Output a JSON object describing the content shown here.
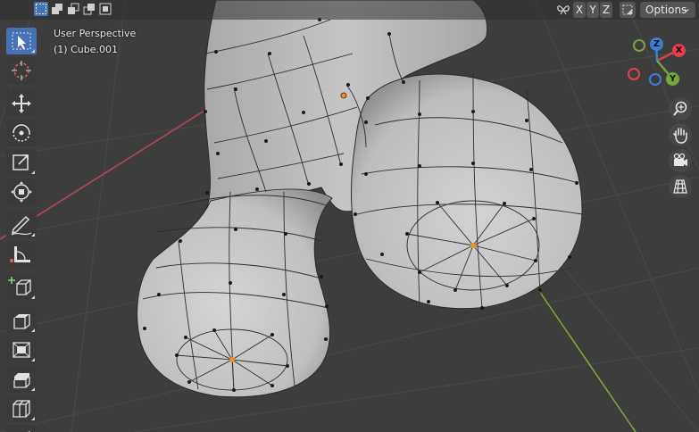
{
  "viewport": {
    "mode": "User Perspective",
    "object": "(1) Cube.001"
  },
  "header": {
    "axis_x": "X",
    "axis_y": "Y",
    "axis_z": "Z",
    "options_label": "Options",
    "options_arrow": "⌄"
  },
  "gizmo": {
    "x_label": "X",
    "y_label": "Y",
    "z_label": "Z"
  },
  "colors": {
    "accent": "#4772b3",
    "x_axis": "#e3404f",
    "y_axis": "#77a83a",
    "z_axis": "#3e7fd6",
    "mesh_surface": "#c8c8c8",
    "background": "#3d3d3d"
  },
  "icons": [
    "select-box-icon",
    "cursor-icon",
    "move-icon",
    "rotate-icon",
    "scale-icon",
    "transform-icon",
    "annotate-icon",
    "measure-icon",
    "add-cube-icon",
    "extrude-icon",
    "inset-icon",
    "bevel-icon",
    "loop-cut-icon",
    "zoom-icon",
    "pan-hand-icon",
    "camera-icon",
    "grid-icon"
  ]
}
